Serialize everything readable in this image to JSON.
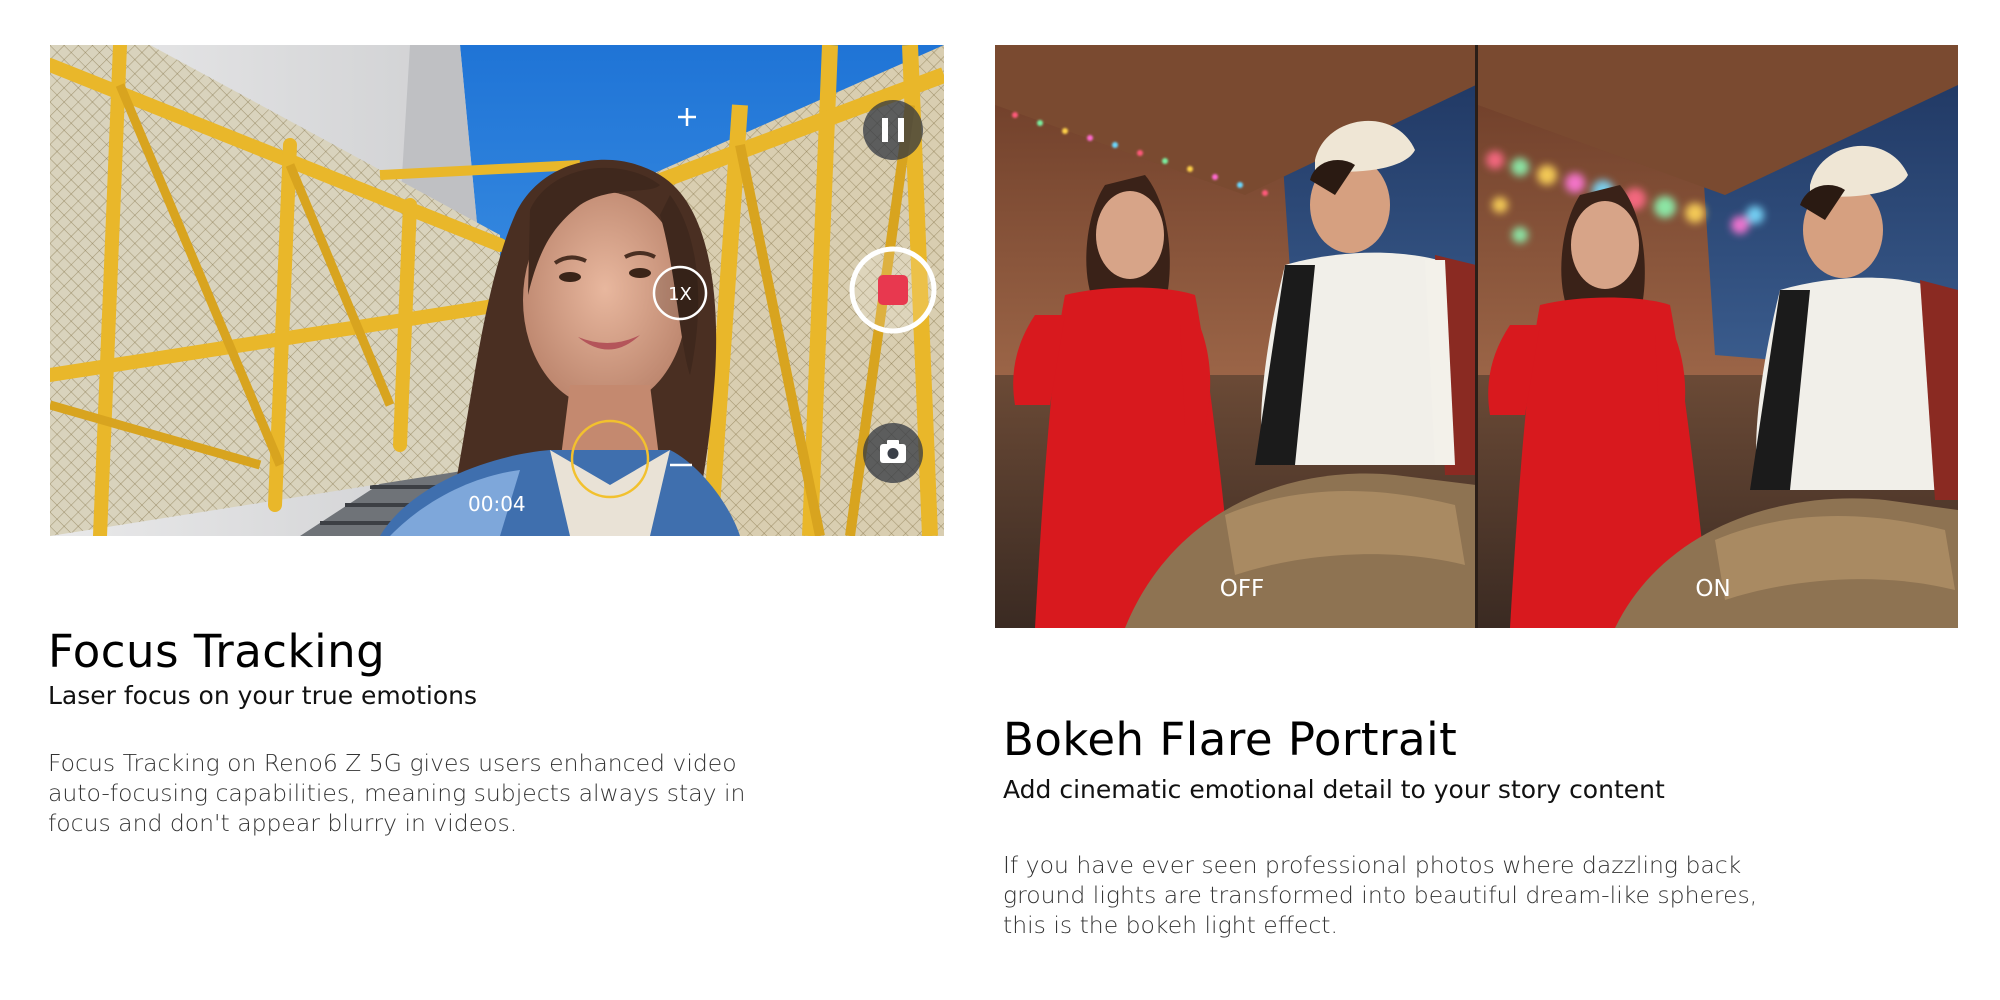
{
  "left_panel": {
    "camera_ui": {
      "zoom_label": "1X",
      "timer": "00:04"
    },
    "title": "Focus Tracking",
    "subtitle": "Laser focus on your true emotions",
    "body_lines": [
      "Focus Tracking on Reno6 Z 5G gives users enhanced video",
      "auto-focusing capabilities, meaning subjects always stay in",
      "focus and don't appear blurry in videos."
    ]
  },
  "right_panel": {
    "compare_labels": {
      "off": "OFF",
      "on": "ON"
    },
    "title": "Bokeh Flare Portrait",
    "subtitle": "Add cinematic emotional detail to your story content",
    "body_lines": [
      "If you have ever seen professional photos where dazzling back",
      "ground lights are transformed into beautiful dream-like spheres,",
      "this is the bokeh light effect."
    ]
  },
  "colors": {
    "record_red": "#e8384f",
    "focus_ring_yellow": "#f2c12e",
    "rail_yellow": "#e9b72a",
    "sky_blue": "#2f86e0"
  }
}
